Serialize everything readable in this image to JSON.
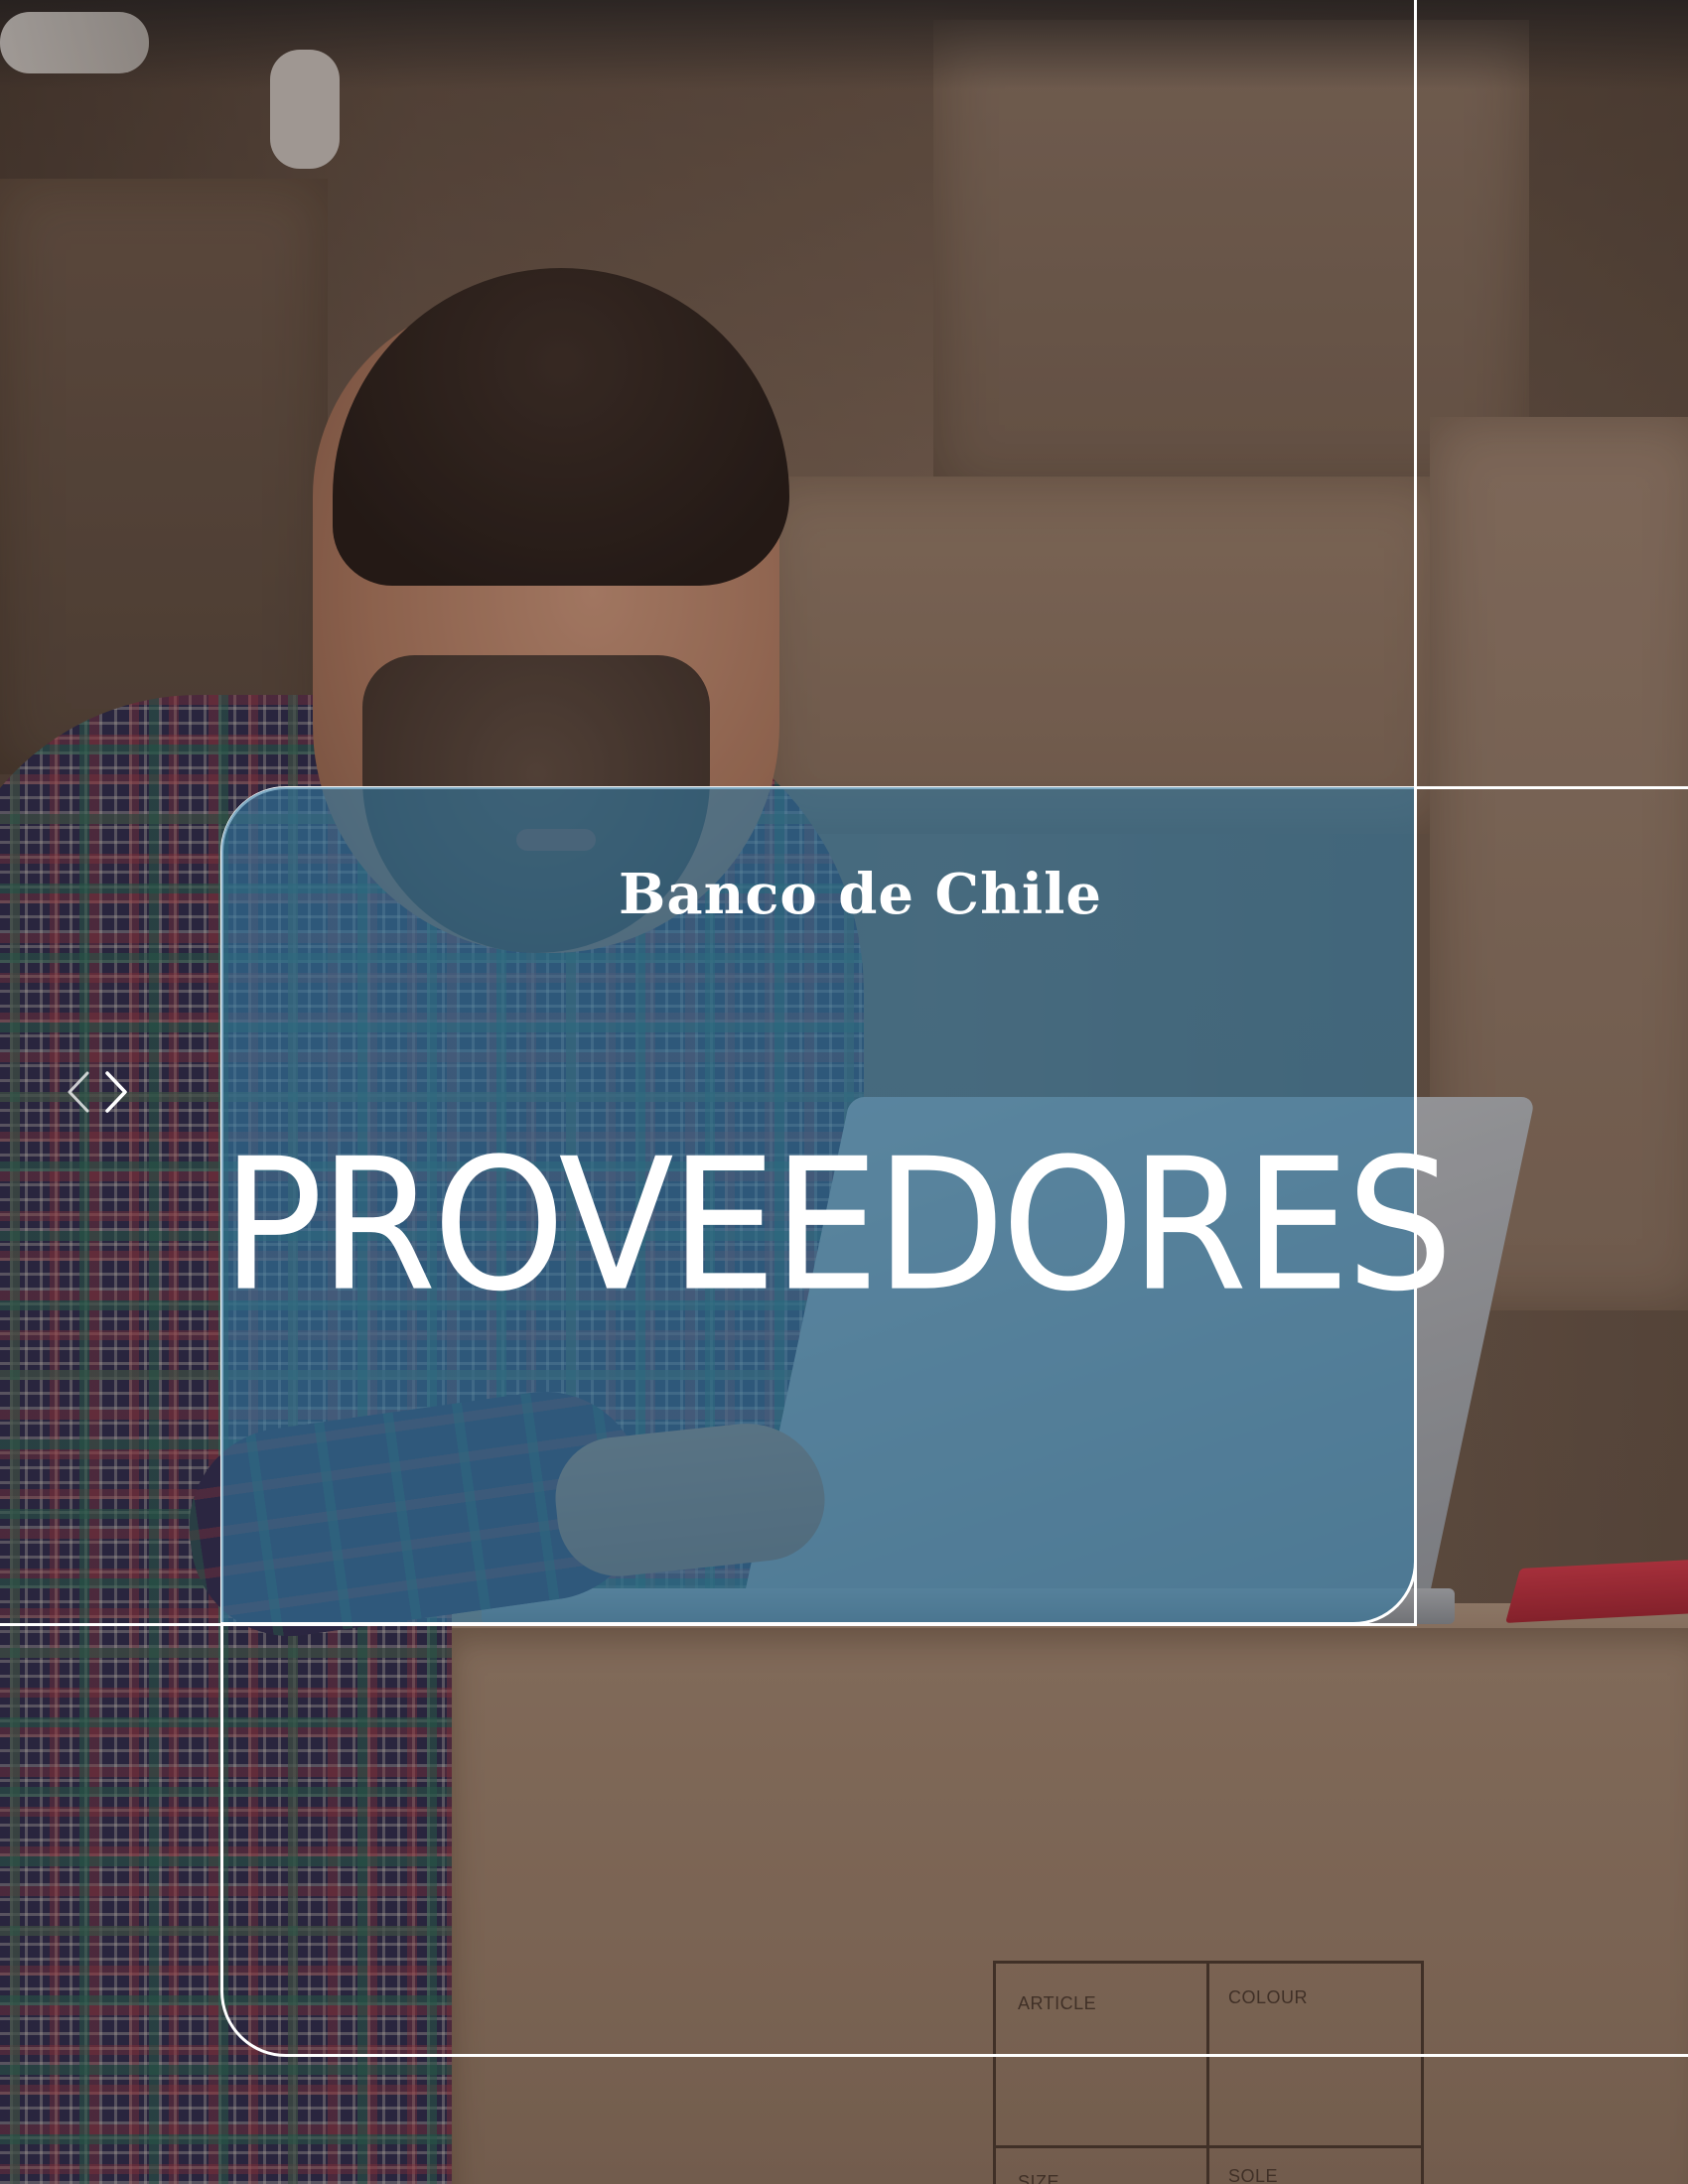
{
  "brand": {
    "logo_text": "Banco de Chile"
  },
  "cover": {
    "title": "PROVEEDORES"
  },
  "box_label": {
    "cell_1": "ARTICLE",
    "cell_2": "COLOUR",
    "cell_3": "SIZE",
    "cell_4": "SOLE"
  },
  "icons": {
    "nav": "chevron-left-right-icon"
  },
  "colors": {
    "overlay_blue": "#3278a0",
    "frame_white": "#ffffff"
  }
}
